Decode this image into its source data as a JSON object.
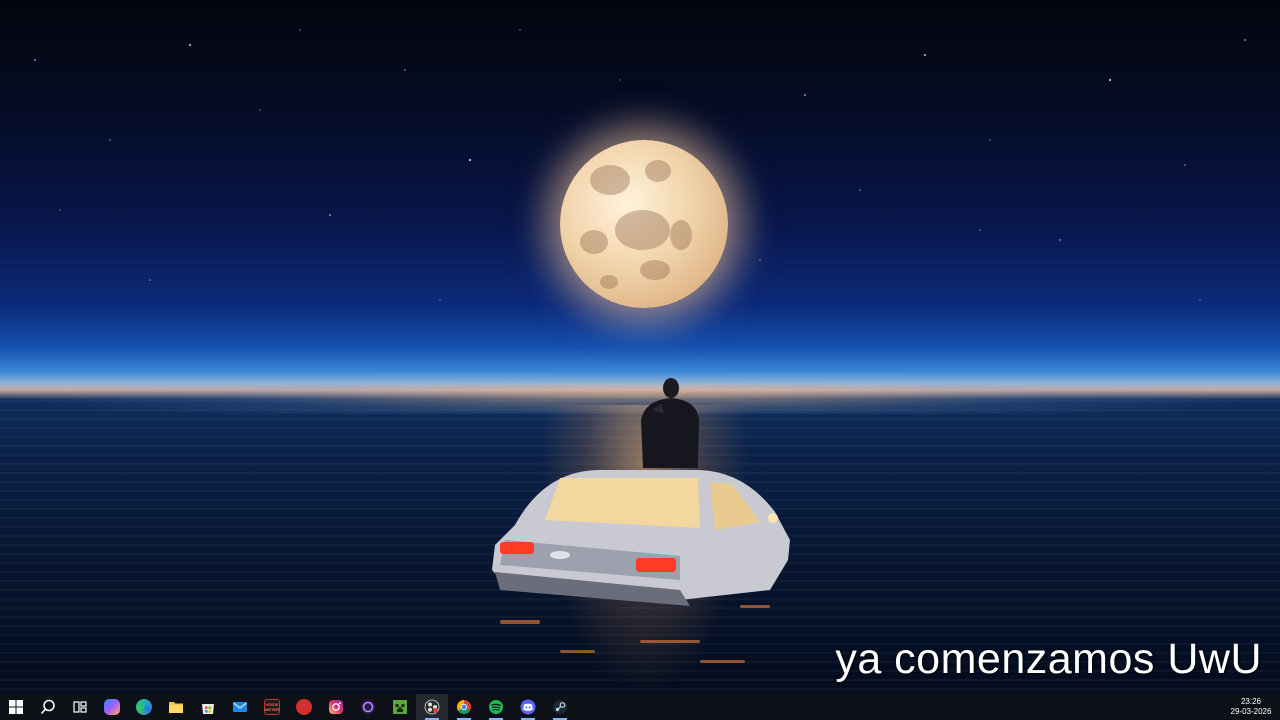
{
  "wallpaper": {
    "caption": "ya comenzamos UwU"
  },
  "taskbar": {
    "items": [
      {
        "name": "start-button",
        "icon": "windows-logo-icon"
      },
      {
        "name": "search-button",
        "icon": "search-icon"
      },
      {
        "name": "task-view-button",
        "icon": "task-view-icon"
      },
      {
        "name": "copilot-button",
        "icon": "copilot-icon"
      },
      {
        "name": "edge-button",
        "icon": "edge-icon"
      },
      {
        "name": "file-explorer-button",
        "icon": "folder-icon"
      },
      {
        "name": "microsoft-store-button",
        "icon": "store-icon"
      },
      {
        "name": "mail-button",
        "icon": "mail-icon"
      },
      {
        "name": "voicemeeter-button",
        "icon": "voicemeeter-icon",
        "label": "VOICE METER"
      },
      {
        "name": "red-app-button",
        "icon": "red-app-icon"
      },
      {
        "name": "instagram-button",
        "icon": "instagram-icon"
      },
      {
        "name": "purple-app-button",
        "icon": "purple-circle-icon"
      },
      {
        "name": "minecraft-button",
        "icon": "minecraft-icon"
      },
      {
        "name": "obs-button",
        "icon": "obs-icon"
      },
      {
        "name": "chrome-button",
        "icon": "chrome-icon"
      },
      {
        "name": "spotify-button",
        "icon": "spotify-icon"
      },
      {
        "name": "discord-button",
        "icon": "discord-icon"
      },
      {
        "name": "steam-button",
        "icon": "steam-icon"
      }
    ],
    "clock": {
      "time": "23:26",
      "date": "29-03-2026"
    }
  },
  "colors": {
    "taskbar_bg": "#0d1017",
    "running_indicator": "#8ab4f8"
  }
}
